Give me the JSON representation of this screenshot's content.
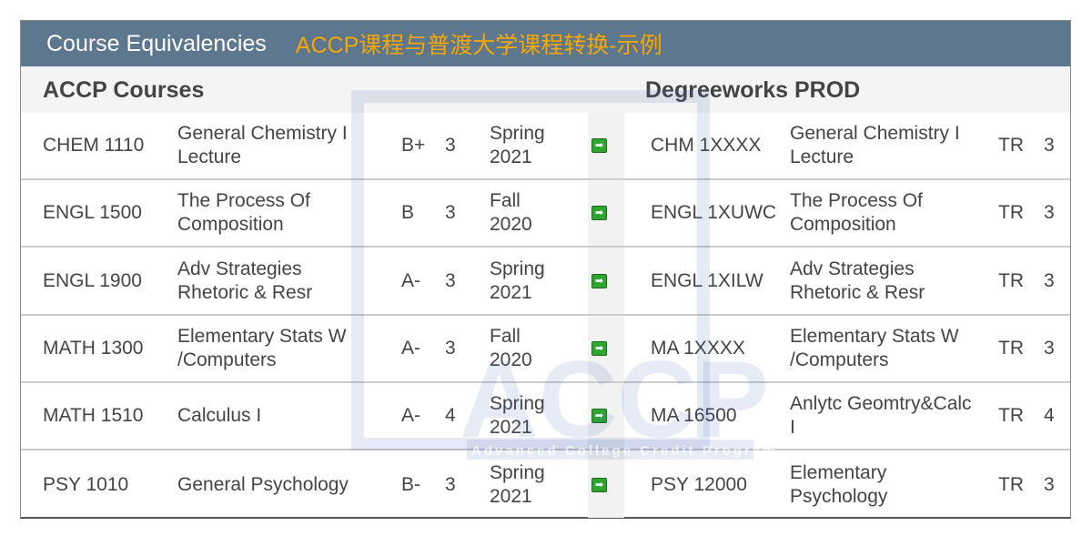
{
  "header": {
    "title": "Course Equivalencies",
    "subtitle": "ACCP课程与普渡大学课程转换-示例"
  },
  "columns": {
    "left": "ACCP Courses",
    "right": "Degreeworks PROD"
  },
  "watermark": {
    "logo": "ACCP",
    "tagline": "Advanced College Credit Program"
  },
  "icons": {
    "transfer": "green-arrow-right-icon"
  },
  "rows": [
    {
      "code": "CHEM 1110",
      "title": "General Chemistry I Lecture",
      "grade": "B+",
      "credits": "3",
      "term": "Spring 2021",
      "to_code": "CHM 1XXXX",
      "to_title": "General Chemistry I Lecture",
      "to_grade": "TR",
      "to_credits": "3"
    },
    {
      "code": "ENGL 1500",
      "title": "The Process Of Composition",
      "grade": "B",
      "credits": "3",
      "term": "Fall 2020",
      "to_code": "ENGL 1XUWC",
      "to_title": "The Process Of Composition",
      "to_grade": "TR",
      "to_credits": "3"
    },
    {
      "code": "ENGL 1900",
      "title": "Adv Strategies Rhetoric & Resr",
      "grade": "A-",
      "credits": "3",
      "term": "Spring 2021",
      "to_code": "ENGL 1XILW",
      "to_title": "Adv Strategies Rhetoric & Resr",
      "to_grade": "TR",
      "to_credits": "3"
    },
    {
      "code": "MATH 1300",
      "title": "Elementary Stats W /Computers",
      "grade": "A-",
      "credits": "3",
      "term": "Fall 2020",
      "to_code": "MA 1XXXX",
      "to_title": "Elementary Stats W /Computers",
      "to_grade": "TR",
      "to_credits": "3"
    },
    {
      "code": "MATH 1510",
      "title": "Calculus I",
      "grade": "A-",
      "credits": "4",
      "term": "Spring 2021",
      "to_code": "MA 16500",
      "to_title": "Anlytc Geomtry&Calc I",
      "to_grade": "TR",
      "to_credits": "4"
    },
    {
      "code": "PSY 1010",
      "title": "General Psychology",
      "grade": "B-",
      "credits": "3",
      "term": "Spring 2021",
      "to_code": "PSY 12000",
      "to_title": "Elementary Psychology",
      "to_grade": "TR",
      "to_credits": "3"
    }
  ]
}
